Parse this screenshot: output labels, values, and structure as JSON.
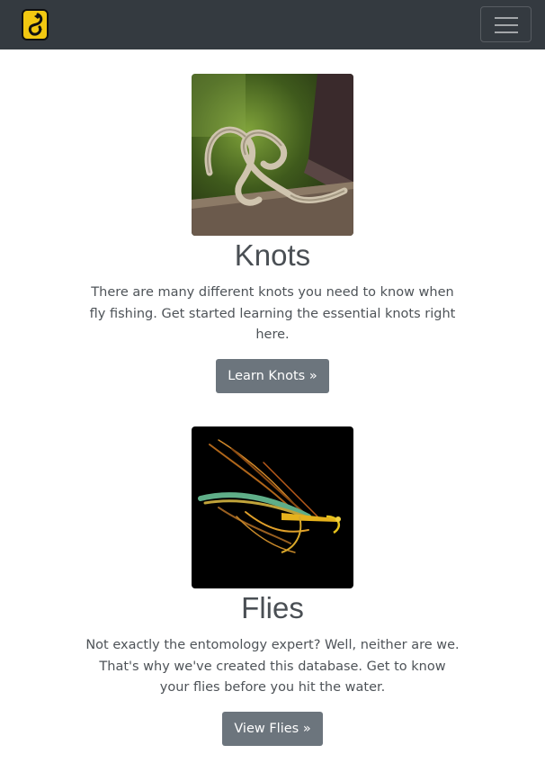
{
  "navbar": {
    "logo_icon": "fish-hook-logo-icon",
    "menu_icon": "hamburger-menu-icon",
    "brand_color": "#f2c811",
    "background": "#343a40"
  },
  "cards": [
    {
      "image_icon": "rope-knot-image",
      "title": "Knots",
      "text": "There are many different knots you need to know when fly fishing. Get started learning the essential knots right here.",
      "button_label": "Learn Knots »"
    },
    {
      "image_icon": "fishing-fly-image",
      "title": "Flies",
      "text": "Not exactly the entomology expert? Well, neither are we. That's why we've created this database. Get to know your flies before you hit the water.",
      "button_label": "View Flies »"
    }
  ],
  "colors": {
    "button": "#6c757d",
    "text": "#4a4f54"
  }
}
